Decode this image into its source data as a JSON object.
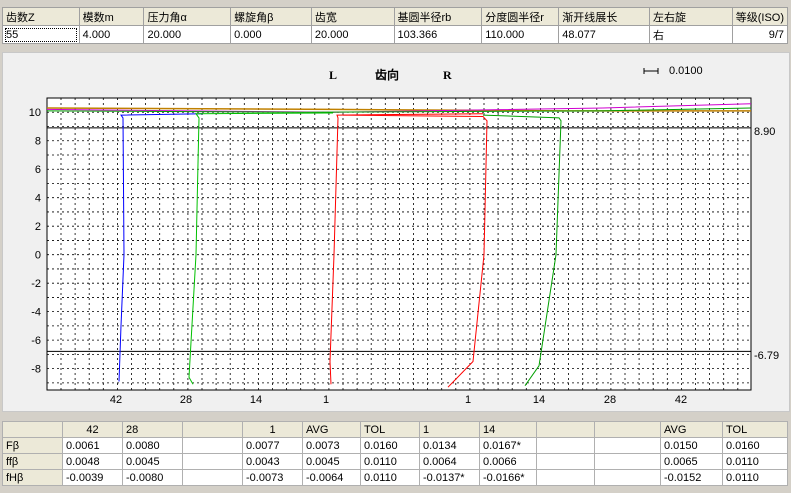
{
  "params": {
    "headers": [
      "齿数Z",
      "模数m",
      "压力角α",
      "螺旋角β",
      "齿宽",
      "基圆半径rb",
      "分度圆半径r",
      "渐开线展长",
      "左右旋",
      "等级(ISO)"
    ],
    "values": [
      "55",
      "4.000",
      "20.000",
      "0.000",
      "20.000",
      "103.366",
      "110.000",
      "48.077",
      "右",
      "9/7"
    ]
  },
  "chart": {
    "left_label": "L",
    "title": "齿向",
    "right_label": "R",
    "scale_label": "0.0100",
    "upper_limit_label": "8.90",
    "lower_limit_label": "-6.79",
    "y_ticks": [
      "10",
      "8",
      "6",
      "4",
      "2",
      "0",
      "-2",
      "-4",
      "-6",
      "-8"
    ],
    "x_ticks": [
      "42",
      "28",
      "14",
      "1",
      "1",
      "14",
      "28",
      "42"
    ]
  },
  "chart_data": {
    "type": "line",
    "title": "齿向",
    "y_ticks": [
      10,
      8,
      6,
      4,
      2,
      0,
      -2,
      -4,
      -6,
      -8
    ],
    "ylim": [
      -9.5,
      11
    ],
    "limits": {
      "upper": 8.9,
      "lower": -6.79
    },
    "x_tick_labels": [
      "42",
      "28",
      "14",
      "1",
      "1",
      "14",
      "28",
      "42"
    ],
    "series": [
      {
        "color": "#0000ff",
        "tooth": "42",
        "flank": "L"
      },
      {
        "color": "#00c000",
        "tooth": "28",
        "flank": "L"
      },
      {
        "color": "#ff0000",
        "tooth": "1",
        "flank": "L"
      },
      {
        "color": "#ff0000",
        "tooth": "1",
        "flank": "R"
      },
      {
        "color": "#00a000",
        "tooth": "14",
        "flank": "R"
      }
    ]
  },
  "results": {
    "header": [
      "",
      "42",
      "28",
      "",
      "1",
      "AVG",
      "TOL",
      "1",
      "14",
      "",
      "",
      "AVG",
      "TOL"
    ],
    "rows": [
      [
        "Fβ",
        "0.0061",
        "0.0080",
        "",
        "0.0077",
        "0.0073",
        "0.0160",
        "0.0134",
        "0.0167*",
        "",
        "",
        "0.0150",
        "0.0160"
      ],
      [
        "ffβ",
        "0.0048",
        "0.0045",
        "",
        "0.0043",
        "0.0045",
        "0.0110",
        "0.0064",
        "0.0066",
        "",
        "",
        "0.0065",
        "0.0110"
      ],
      [
        "fHβ",
        "-0.0039",
        "-0.0080",
        "",
        "-0.0073",
        "-0.0064",
        "0.0110",
        "-0.0137*",
        "-0.0166*",
        "",
        "",
        "-0.0152",
        "0.0110"
      ]
    ]
  }
}
